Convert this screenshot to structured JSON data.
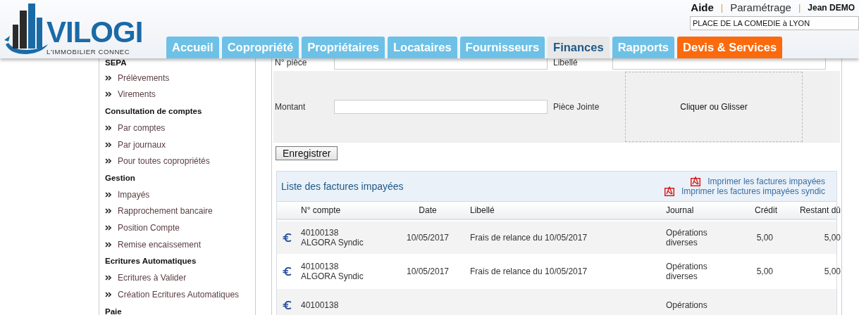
{
  "header": {
    "logo": {
      "name": "VILOGI",
      "tagline": "L'IMMOBILIER CONNEC"
    },
    "top_bar": [
      {
        "kind": "link",
        "text": "Aide"
      },
      {
        "kind": "separator",
        "text": "|"
      },
      {
        "kind": "link",
        "text": "Paramétrage"
      },
      {
        "kind": "separator",
        "text": "|"
      },
      {
        "kind": "user",
        "text": "Jean DEMO"
      }
    ],
    "property_field": {
      "value": "PLACE DE LA COMEDIE à LYON"
    }
  },
  "tabs": [
    {
      "label": "Accueil",
      "selected": false,
      "kind": "standard"
    },
    {
      "label": "Copropriété",
      "selected": false,
      "kind": "standard"
    },
    {
      "label": "Propriétaires",
      "selected": false,
      "kind": "standard"
    },
    {
      "label": "Locataires",
      "selected": false,
      "kind": "standard"
    },
    {
      "label": "Fournisseurs",
      "selected": false,
      "kind": "standard"
    },
    {
      "label": "Finances",
      "selected": true,
      "kind": "standard"
    },
    {
      "label": "Rapports",
      "selected": false,
      "kind": "standard"
    },
    {
      "label": "Devis & Services",
      "selected": false,
      "kind": "promo"
    }
  ],
  "sidebar": {
    "sections": [
      {
        "title": "SEPA",
        "items": [
          "Prélèvements",
          "Virements"
        ]
      },
      {
        "title": "Consultation de comptes",
        "items": [
          "Par comptes",
          "Par journaux",
          "Pour toutes copropriétés"
        ]
      },
      {
        "title": "Gestion",
        "items": [
          "Impayés",
          "Rapprochement bancaire",
          "Position Compte",
          "Remise encaissement"
        ]
      },
      {
        "title": "Ecritures Automatiques",
        "items": [
          "Ecritures à Valider",
          "Création Ecritures Automatiques"
        ]
      },
      {
        "title": "Paie"
      }
    ]
  },
  "form": {
    "rows": [
      {
        "fields": [
          {
            "label": "N° pièce",
            "kind": "input"
          },
          {
            "label": "Libellé",
            "kind": "input"
          }
        ]
      },
      {
        "fields": [
          {
            "label": "Montant",
            "kind": "input"
          },
          {
            "label": "Pièce Jointe",
            "kind": "dropzone",
            "text": "Cliquer ou Glisser"
          }
        ]
      }
    ],
    "submit": "Enregistrer"
  },
  "table": {
    "title": "Liste des factures impayées",
    "print_links": [
      "Imprimer les factures impayées",
      "Imprimer les factures impayées syndic"
    ],
    "columns": [
      "N° compte",
      "Date",
      "Libellé",
      "Journal",
      "Crédit",
      "Restant dû"
    ],
    "rows": [
      {
        "account": [
          "40100138",
          "ALGORA Syndic"
        ],
        "date": "10/05/2017",
        "label": "Frais de relance du 10/05/2017",
        "journal": [
          "Opérations",
          "diverses"
        ],
        "credit": "5,00",
        "remaining": "5,00"
      },
      {
        "account": [
          "40100138",
          "ALGORA Syndic"
        ],
        "date": "10/05/2017",
        "label": "Frais de relance du 10/05/2017",
        "journal": [
          "Opérations",
          "diverses"
        ],
        "credit": "5,00",
        "remaining": "5,00"
      },
      {
        "account": [
          "40100138"
        ],
        "journal": [
          "Opérations"
        ]
      }
    ]
  }
}
